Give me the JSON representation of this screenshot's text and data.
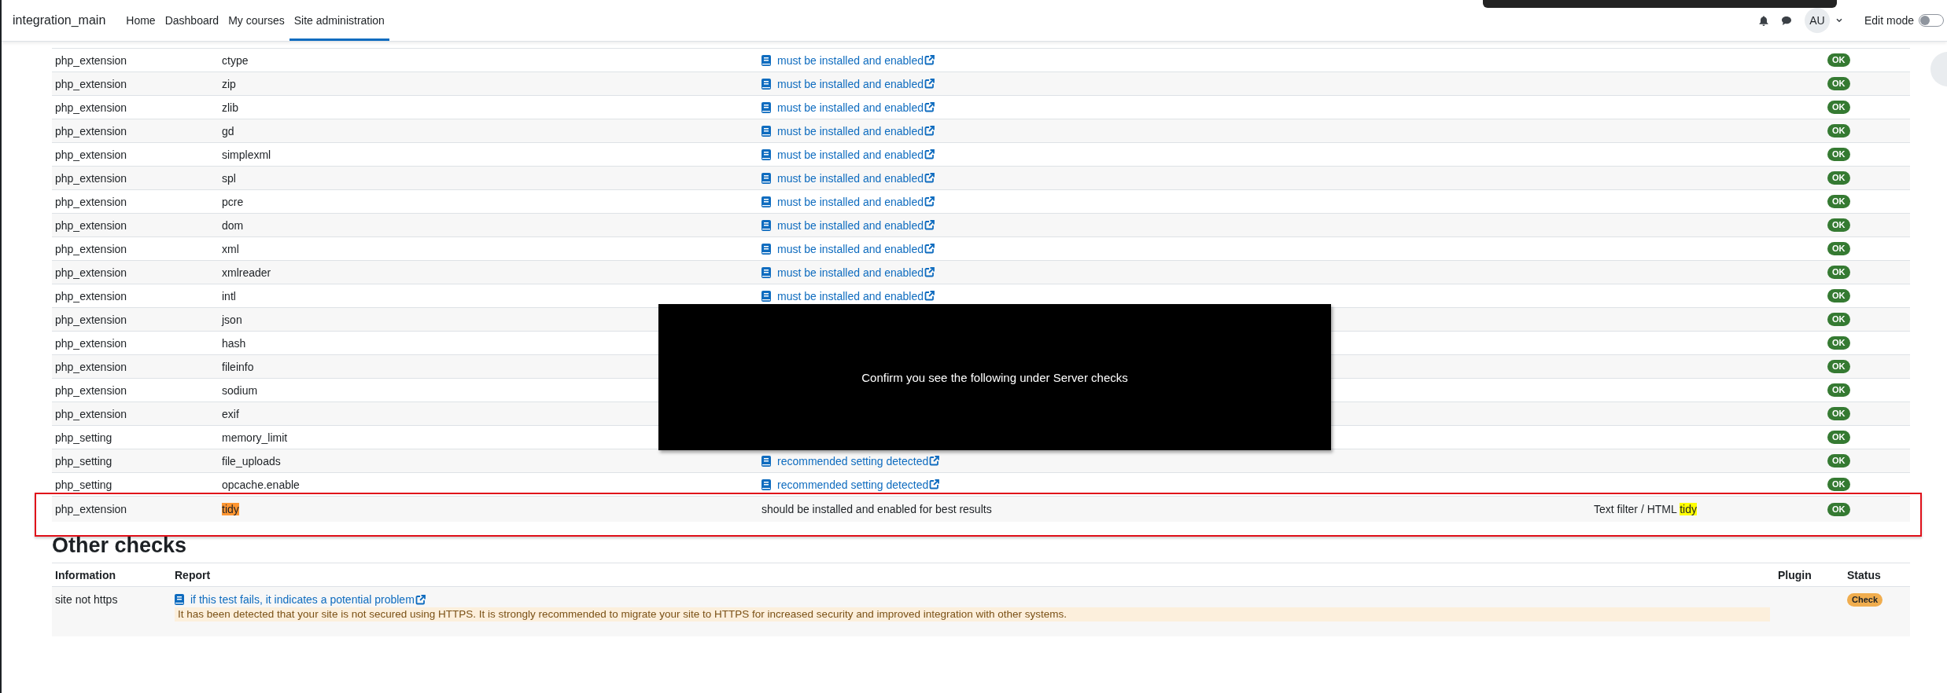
{
  "navbar": {
    "brand": "integration_main",
    "nav": [
      {
        "label": "Home",
        "selected": false
      },
      {
        "label": "Dashboard",
        "selected": false
      },
      {
        "label": "My courses",
        "selected": false
      },
      {
        "label": "Site administration",
        "selected": true
      }
    ],
    "avatar": "AU",
    "edit_mode": {
      "label": "Edit mode",
      "on": false
    }
  },
  "server_checks": {
    "rows": [
      {
        "kind": "link",
        "name": "php_extension",
        "info": "ctype",
        "name_highlighted": false,
        "report": "must be installed and enabled",
        "status": "OK",
        "outlined": false
      },
      {
        "kind": "link",
        "name": "php_extension",
        "info": "zip",
        "name_highlighted": false,
        "report": "must be installed and enabled",
        "status": "OK",
        "outlined": false
      },
      {
        "kind": "link",
        "name": "php_extension",
        "info": "zlib",
        "name_highlighted": false,
        "report": "must be installed and enabled",
        "status": "OK",
        "outlined": false
      },
      {
        "kind": "link",
        "name": "php_extension",
        "info": "gd",
        "name_highlighted": false,
        "report": "must be installed and enabled",
        "status": "OK",
        "outlined": false
      },
      {
        "kind": "link",
        "name": "php_extension",
        "info": "simplexml",
        "name_highlighted": false,
        "report": "must be installed and enabled",
        "status": "OK",
        "outlined": false
      },
      {
        "kind": "link",
        "name": "php_extension",
        "info": "spl",
        "name_highlighted": false,
        "report": "must be installed and enabled",
        "status": "OK",
        "outlined": false
      },
      {
        "kind": "link",
        "name": "php_extension",
        "info": "pcre",
        "name_highlighted": false,
        "report": "must be installed and enabled",
        "status": "OK",
        "outlined": false
      },
      {
        "kind": "link",
        "name": "php_extension",
        "info": "dom",
        "name_highlighted": false,
        "report": "must be installed and enabled",
        "status": "OK",
        "outlined": false
      },
      {
        "kind": "link",
        "name": "php_extension",
        "info": "xml",
        "name_highlighted": false,
        "report": "must be installed and enabled",
        "status": "OK",
        "outlined": false
      },
      {
        "kind": "link",
        "name": "php_extension",
        "info": "xmlreader",
        "name_highlighted": false,
        "report": "must be installed and enabled",
        "status": "OK",
        "outlined": false
      },
      {
        "kind": "link",
        "name": "php_extension",
        "info": "intl",
        "name_highlighted": false,
        "report": "must be installed and enabled",
        "status": "OK",
        "outlined": false
      },
      {
        "kind": "link",
        "name": "php_extension",
        "info": "json",
        "name_highlighted": false,
        "status": "OK",
        "outlined": false
      },
      {
        "kind": "link",
        "name": "php_extension",
        "info": "hash",
        "name_highlighted": false,
        "status": "OK",
        "outlined": false
      },
      {
        "kind": "link",
        "name": "php_extension",
        "info": "fileinfo",
        "name_highlighted": false,
        "status": "OK",
        "outlined": false
      },
      {
        "kind": "link",
        "name": "php_extension",
        "info": "sodium",
        "name_highlighted": false,
        "status": "OK",
        "outlined": false
      },
      {
        "kind": "link",
        "name": "php_extension",
        "info": "exif",
        "name_highlighted": false,
        "status": "OK",
        "outlined": false
      },
      {
        "kind": "link",
        "name": "php_setting",
        "info": "memory_limit",
        "name_highlighted": false,
        "status": "OK",
        "outlined": false
      },
      {
        "kind": "link",
        "name": "php_setting",
        "info": "file_uploads",
        "name_highlighted": false,
        "report": "recommended setting detected",
        "status": "OK",
        "outlined": false
      },
      {
        "kind": "link",
        "name": "php_setting",
        "info": "opcache.enable",
        "name_highlighted": false,
        "report": "recommended setting detected",
        "status": "OK",
        "outlined": false
      },
      {
        "kind": "text",
        "name": "php_extension",
        "info": "tidy",
        "name_highlighted": true,
        "report": "should be installed and enabled for best results",
        "plugin": {
          "text": "Text filter / HTML",
          "highlight": "tidy"
        },
        "status": "OK",
        "outlined": true
      }
    ]
  },
  "other_checks": {
    "heading": "Other checks",
    "columns": [
      "Information",
      "Report",
      "Plugin",
      "Status"
    ],
    "rows": [
      {
        "info": "site not https",
        "link": "if this test fails, it indicates a potential problem",
        "warning": "It has been detected that your site is not secured using HTTPS. It is strongly recommended to migrate your site to HTTPS for increased security and improved integration with other systems.",
        "status": "Check"
      }
    ]
  },
  "overlay": {
    "text": "Confirm you see the following under Server checks"
  }
}
